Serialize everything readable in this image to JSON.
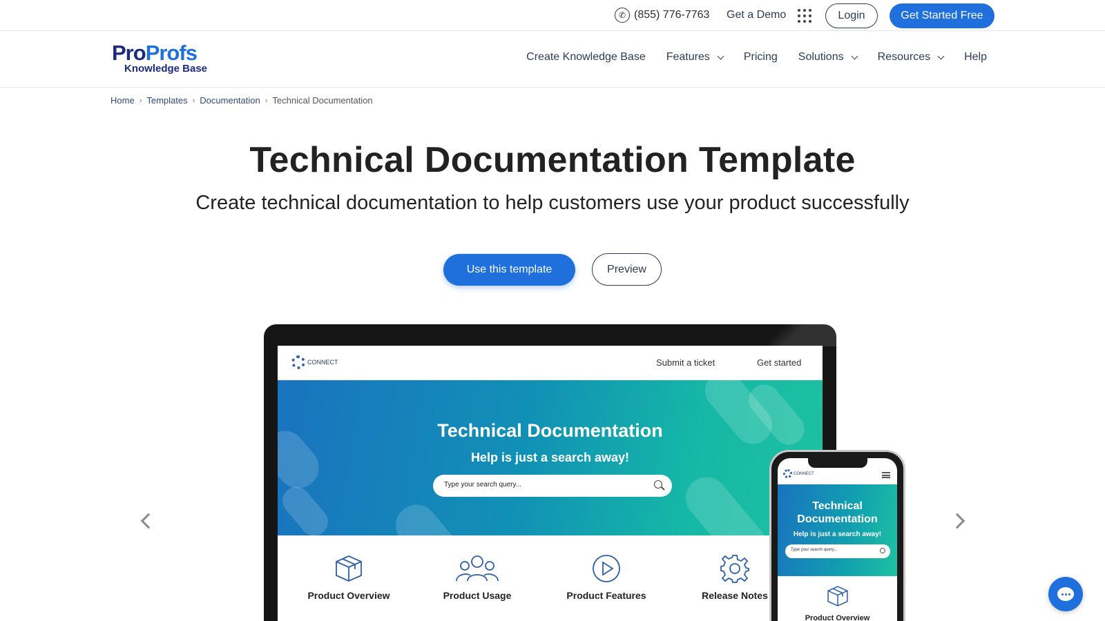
{
  "topbar": {
    "phone": "(855) 776-7763",
    "get_demo": "Get a Demo",
    "login": "Login",
    "get_started": "Get Started Free"
  },
  "logo": {
    "brand_pro": "Pro",
    "brand_profs": "Profs",
    "subtitle": "Knowledge Base"
  },
  "nav": {
    "items": [
      {
        "label": "Create Knowledge Base",
        "dropdown": false
      },
      {
        "label": "Features",
        "dropdown": true
      },
      {
        "label": "Pricing",
        "dropdown": false
      },
      {
        "label": "Solutions",
        "dropdown": true
      },
      {
        "label": "Resources",
        "dropdown": true
      },
      {
        "label": "Help",
        "dropdown": false
      }
    ]
  },
  "breadcrumb": {
    "items": [
      "Home",
      "Templates",
      "Documentation",
      "Technical Documentation"
    ]
  },
  "hero": {
    "title": "Technical Documentation Template",
    "subtitle": "Create technical documentation to help customers use your product successfully",
    "use_template": "Use this template",
    "preview": "Preview"
  },
  "mockup": {
    "logo_text": "CONNECT",
    "submit_ticket": "Submit a ticket",
    "get_started": "Get started",
    "banner_title": "Technical Documentation",
    "banner_tagline": "Help is just a search away!",
    "search_placeholder": "Type your search query...",
    "categories": [
      {
        "label": "Product Overview",
        "icon": "box-icon"
      },
      {
        "label": "Product Usage",
        "icon": "users-icon"
      },
      {
        "label": "Product Features",
        "icon": "play-icon"
      },
      {
        "label": "Release Notes",
        "icon": "gear-icon"
      }
    ]
  },
  "phone_mockup": {
    "logo_text": "CONNECT",
    "banner_title": "Technical Documentation",
    "banner_tagline": "Help is just a search away!",
    "search_placeholder": "Type your search query...",
    "category": "Product Overview"
  },
  "colors": {
    "primary": "#1f6fdc",
    "navy": "#1b2b7a",
    "text": "#222222"
  }
}
